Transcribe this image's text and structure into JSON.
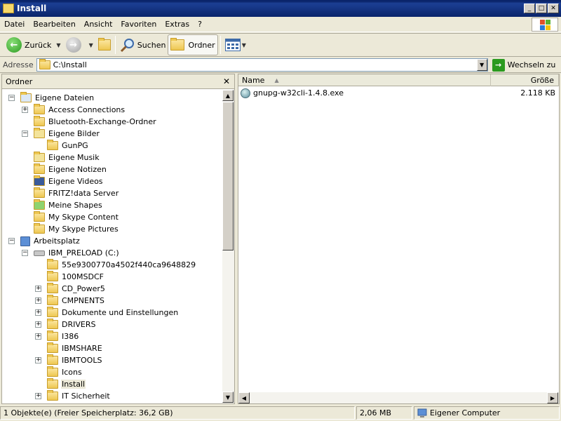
{
  "window": {
    "title": "Install"
  },
  "menu": [
    "Datei",
    "Bearbeiten",
    "Ansicht",
    "Favoriten",
    "Extras",
    "?"
  ],
  "toolbar": {
    "back": "Zurück",
    "search": "Suchen",
    "folders": "Ordner"
  },
  "address": {
    "label": "Adresse",
    "value": "C:\\Install",
    "go": "Wechseln zu"
  },
  "tree": {
    "header": "Ordner",
    "items": [
      {
        "label": "Eigene Dateien",
        "expander": "−",
        "icon": "my-documents-icon"
      },
      {
        "label": "Access Connections",
        "expander": "+",
        "icon": "folder-icon"
      },
      {
        "label": "Bluetooth-Exchange-Ordner",
        "expander": "",
        "icon": "folder-icon"
      },
      {
        "label": "Eigene Bilder",
        "expander": "−",
        "icon": "my-pictures-icon"
      },
      {
        "label": "GunPG",
        "expander": "",
        "icon": "folder-icon"
      },
      {
        "label": "Eigene Musik",
        "expander": "",
        "icon": "my-music-icon"
      },
      {
        "label": "Eigene Notizen",
        "expander": "",
        "icon": "folder-icon"
      },
      {
        "label": "Eigene Videos",
        "expander": "",
        "icon": "my-videos-icon"
      },
      {
        "label": "FRITZ!data Server",
        "expander": "",
        "icon": "folder-icon"
      },
      {
        "label": "Meine Shapes",
        "expander": "",
        "icon": "shapes-folder-icon"
      },
      {
        "label": "My Skype Content",
        "expander": "",
        "icon": "folder-icon"
      },
      {
        "label": "My Skype Pictures",
        "expander": "",
        "icon": "folder-icon"
      },
      {
        "label": "Arbeitsplatz",
        "expander": "−",
        "icon": "my-computer-icon"
      },
      {
        "label": "IBM_PRELOAD (C:)",
        "expander": "−",
        "icon": "drive-icon"
      },
      {
        "label": "55e9300770a4502f440ca9648829",
        "expander": "",
        "icon": "folder-icon"
      },
      {
        "label": "100MSDCF",
        "expander": "",
        "icon": "folder-icon"
      },
      {
        "label": "CD_Power5",
        "expander": "+",
        "icon": "folder-icon"
      },
      {
        "label": "CMPNENTS",
        "expander": "+",
        "icon": "folder-icon"
      },
      {
        "label": "Dokumente und Einstellungen",
        "expander": "+",
        "icon": "folder-icon"
      },
      {
        "label": "DRIVERS",
        "expander": "+",
        "icon": "folder-icon"
      },
      {
        "label": "I386",
        "expander": "+",
        "icon": "folder-icon"
      },
      {
        "label": "IBMSHARE",
        "expander": "",
        "icon": "folder-icon"
      },
      {
        "label": "IBMTOOLS",
        "expander": "+",
        "icon": "folder-icon"
      },
      {
        "label": "Icons",
        "expander": "",
        "icon": "folder-icon"
      },
      {
        "label": "Install",
        "expander": "",
        "icon": "folder-icon",
        "selected": true
      },
      {
        "label": "IT Sicherheit",
        "expander": "+",
        "icon": "folder-icon"
      }
    ]
  },
  "list": {
    "columns": {
      "name": "Name",
      "size": "Größe"
    },
    "files": [
      {
        "name": "gnupg-w32cli-1.4.8.exe",
        "size": "2.118 KB",
        "icon": "installer-icon"
      }
    ]
  },
  "status": {
    "objects": "1 Objekte(e) (Freier Speicherplatz: 36,2 GB)",
    "size": "2,06 MB",
    "location": "Eigener Computer"
  }
}
